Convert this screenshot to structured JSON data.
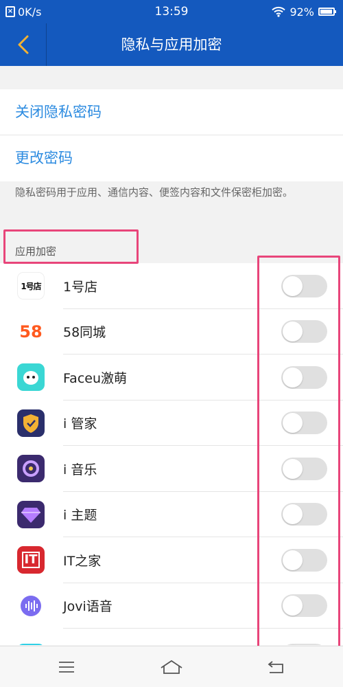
{
  "status": {
    "speed": "0K/s",
    "time": "13:59",
    "battery_percent": "92%",
    "battery_level": 0.92
  },
  "header": {
    "title": "隐私与应用加密"
  },
  "options": [
    {
      "label": "关闭隐私密码"
    },
    {
      "label": "更改密码"
    }
  ],
  "note": "隐私密码用于应用、通信内容、便签内容和文件保密柜加密。",
  "section": {
    "label": "应用加密"
  },
  "apps": [
    {
      "name": "1号店",
      "enabled": false,
      "icon": "yhd-icon",
      "icon_text": "1号店"
    },
    {
      "name": "58同城",
      "enabled": false,
      "icon": "58-icon",
      "icon_text": "58"
    },
    {
      "name": "Faceu激萌",
      "enabled": false,
      "icon": "faceu-icon"
    },
    {
      "name": "i 管家",
      "enabled": false,
      "icon": "shield-icon"
    },
    {
      "name": "i 音乐",
      "enabled": false,
      "icon": "music-disc-icon"
    },
    {
      "name": "i 主题",
      "enabled": false,
      "icon": "diamond-icon"
    },
    {
      "name": "IT之家",
      "enabled": false,
      "icon": "ithome-icon",
      "icon_text": "IT"
    },
    {
      "name": "Jovi语音",
      "enabled": false,
      "icon": "voice-wave-icon"
    }
  ],
  "colors": {
    "primary": "#1459be",
    "link": "#2c8be0",
    "highlight": "#e8457a"
  }
}
